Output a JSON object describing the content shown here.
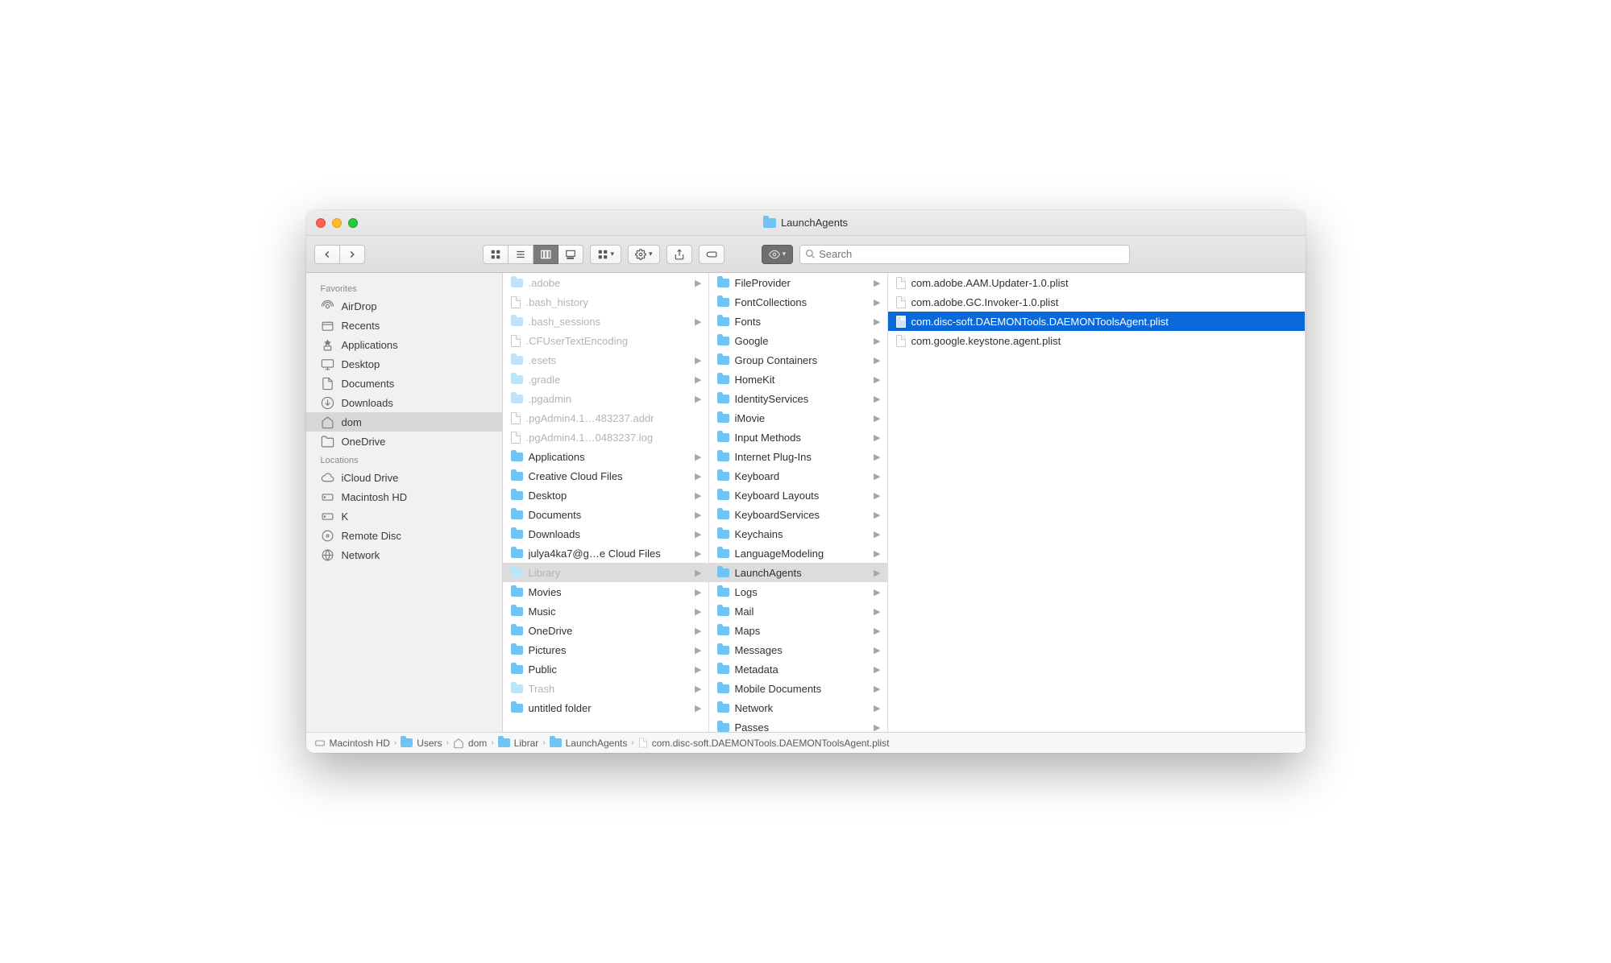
{
  "window": {
    "title": "LaunchAgents"
  },
  "toolbar": {
    "search_placeholder": "Search"
  },
  "sidebar": {
    "sections": [
      {
        "header": "Favorites",
        "items": [
          {
            "icon": "airdrop",
            "label": "AirDrop"
          },
          {
            "icon": "recents",
            "label": "Recents"
          },
          {
            "icon": "apps",
            "label": "Applications"
          },
          {
            "icon": "desktop",
            "label": "Desktop"
          },
          {
            "icon": "documents",
            "label": "Documents"
          },
          {
            "icon": "downloads",
            "label": "Downloads"
          },
          {
            "icon": "home",
            "label": "dom",
            "selected": true
          },
          {
            "icon": "folder",
            "label": "OneDrive"
          }
        ]
      },
      {
        "header": "Locations",
        "items": [
          {
            "icon": "icloud",
            "label": "iCloud Drive"
          },
          {
            "icon": "hd",
            "label": "Macintosh HD"
          },
          {
            "icon": "hd",
            "label": "K"
          },
          {
            "icon": "disc",
            "label": "Remote Disc"
          },
          {
            "icon": "network",
            "label": "Network"
          }
        ]
      }
    ]
  },
  "columns": {
    "col1": [
      {
        "label": ".adobe",
        "type": "folder",
        "dim": true,
        "arrow": true
      },
      {
        "label": ".bash_history",
        "type": "file",
        "dim": true
      },
      {
        "label": ".bash_sessions",
        "type": "folder",
        "dim": true,
        "arrow": true
      },
      {
        "label": ".CFUserTextEncoding",
        "type": "file",
        "dim": true
      },
      {
        "label": ".esets",
        "type": "folder",
        "dim": true,
        "arrow": true
      },
      {
        "label": ".gradle",
        "type": "folder",
        "dim": true,
        "arrow": true
      },
      {
        "label": ".pgadmin",
        "type": "folder",
        "dim": true,
        "arrow": true
      },
      {
        "label": ".pgAdmin4.1…483237.addr",
        "type": "file",
        "dim": true
      },
      {
        "label": ".pgAdmin4.1…0483237.log",
        "type": "file",
        "dim": true
      },
      {
        "label": "Applications",
        "type": "folder",
        "arrow": true
      },
      {
        "label": "Creative Cloud Files",
        "type": "folder",
        "arrow": true
      },
      {
        "label": "Desktop",
        "type": "folder",
        "arrow": true
      },
      {
        "label": "Documents",
        "type": "folder",
        "arrow": true
      },
      {
        "label": "Downloads",
        "type": "folder",
        "arrow": true
      },
      {
        "label": "julya4ka7@g…e Cloud Files",
        "type": "folder",
        "arrow": true
      },
      {
        "label": "Library",
        "type": "folder",
        "dim": true,
        "arrow": true,
        "selected": true
      },
      {
        "label": "Movies",
        "type": "folder",
        "arrow": true
      },
      {
        "label": "Music",
        "type": "folder",
        "arrow": true
      },
      {
        "label": "OneDrive",
        "type": "folder",
        "arrow": true
      },
      {
        "label": "Pictures",
        "type": "folder",
        "arrow": true
      },
      {
        "label": "Public",
        "type": "folder",
        "arrow": true
      },
      {
        "label": "Trash",
        "type": "folder",
        "dim": true,
        "arrow": true
      },
      {
        "label": "untitled folder",
        "type": "folder",
        "arrow": true
      }
    ],
    "col2": [
      {
        "label": "FileProvider",
        "type": "folder",
        "arrow": true
      },
      {
        "label": "FontCollections",
        "type": "folder",
        "arrow": true
      },
      {
        "label": "Fonts",
        "type": "folder",
        "arrow": true
      },
      {
        "label": "Google",
        "type": "folder",
        "arrow": true
      },
      {
        "label": "Group Containers",
        "type": "folder",
        "arrow": true
      },
      {
        "label": "HomeKit",
        "type": "folder",
        "arrow": true
      },
      {
        "label": "IdentityServices",
        "type": "folder",
        "arrow": true
      },
      {
        "label": "iMovie",
        "type": "folder",
        "arrow": true
      },
      {
        "label": "Input Methods",
        "type": "folder",
        "arrow": true
      },
      {
        "label": "Internet Plug-Ins",
        "type": "folder",
        "arrow": true
      },
      {
        "label": "Keyboard",
        "type": "folder",
        "arrow": true
      },
      {
        "label": "Keyboard Layouts",
        "type": "folder",
        "arrow": true
      },
      {
        "label": "KeyboardServices",
        "type": "folder",
        "arrow": true
      },
      {
        "label": "Keychains",
        "type": "folder",
        "arrow": true
      },
      {
        "label": "LanguageModeling",
        "type": "folder",
        "arrow": true
      },
      {
        "label": "LaunchAgents",
        "type": "folder",
        "arrow": true,
        "selected": true
      },
      {
        "label": "Logs",
        "type": "folder",
        "arrow": true
      },
      {
        "label": "Mail",
        "type": "folder",
        "arrow": true
      },
      {
        "label": "Maps",
        "type": "folder",
        "arrow": true
      },
      {
        "label": "Messages",
        "type": "folder",
        "arrow": true
      },
      {
        "label": "Metadata",
        "type": "folder",
        "arrow": true
      },
      {
        "label": "Mobile Documents",
        "type": "folder",
        "arrow": true
      },
      {
        "label": "Network",
        "type": "folder",
        "arrow": true
      },
      {
        "label": "Passes",
        "type": "folder",
        "arrow": true
      }
    ],
    "col3": [
      {
        "label": "com.adobe.AAM.Updater-1.0.plist",
        "type": "file"
      },
      {
        "label": "com.adobe.GC.Invoker-1.0.plist",
        "type": "file"
      },
      {
        "label": "com.disc-soft.DAEMONTools.DAEMONToolsAgent.plist",
        "type": "file",
        "highlighted": true
      },
      {
        "label": "com.google.keystone.agent.plist",
        "type": "file"
      }
    ]
  },
  "path": [
    {
      "icon": "hd",
      "label": "Macintosh HD"
    },
    {
      "icon": "folder",
      "label": "Users"
    },
    {
      "icon": "home",
      "label": "dom"
    },
    {
      "icon": "folder",
      "label": "Librar"
    },
    {
      "icon": "folder",
      "label": "LaunchAgents"
    },
    {
      "icon": "file",
      "label": "com.disc-soft.DAEMONTools.DAEMONToolsAgent.plist"
    }
  ]
}
